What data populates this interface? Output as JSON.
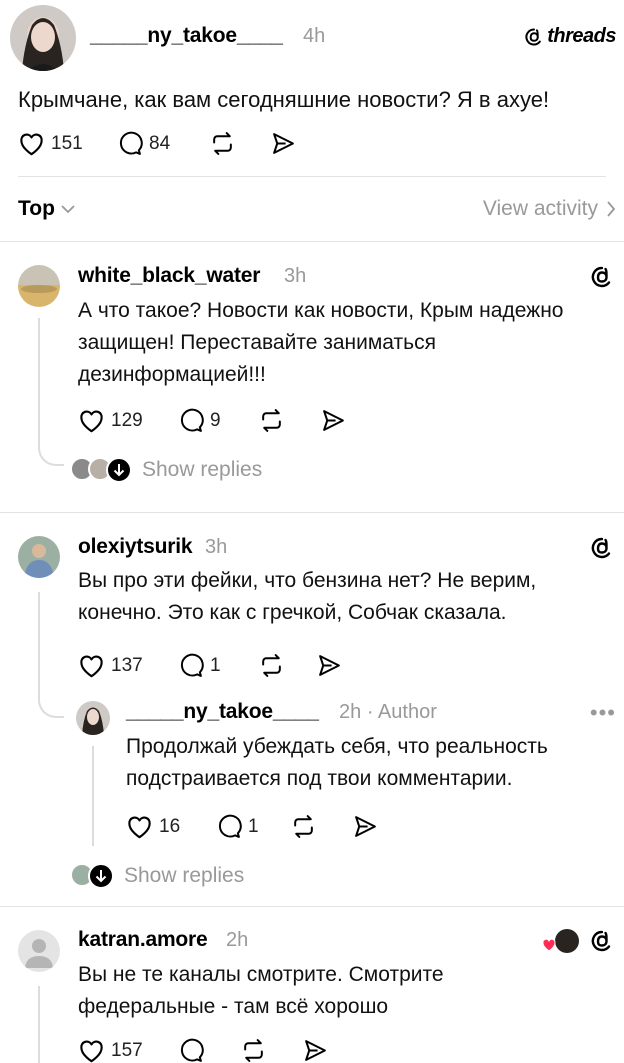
{
  "brand": {
    "logo_text": "threads"
  },
  "post": {
    "author": "_____ny_takoe____",
    "time": "4h",
    "text": "Крымчане, как вам сегодняшние новости? Я в ахуе!",
    "likes": "151",
    "replies": "84"
  },
  "filter": {
    "sort_label": "Top",
    "view_activity": "View activity"
  },
  "comments": [
    {
      "author": "white_black_water",
      "time": "3h",
      "lines": [
        "А что такое? Новости как новости, Крым надежно",
        "защищен! Переставайте заниматься",
        "дезинформацией!!!"
      ],
      "likes": "129",
      "replies": "9",
      "show_replies": "Show replies"
    },
    {
      "author": "olexiytsurik",
      "time": "3h",
      "lines": [
        "Вы про эти фейки, что бензина нет? Не верим,",
        "конечно. Это как с гречкой, Собчак сказала."
      ],
      "likes": "137",
      "replies": "1",
      "reply": {
        "author": "_____ny_takoe____",
        "time": "2h",
        "badge": "· Author",
        "lines": [
          "Продолжай убеждать себя, что реальность",
          "подстраивается под твои комментарии."
        ],
        "likes": "16",
        "replies": "1"
      },
      "show_replies": "Show replies"
    },
    {
      "author": "katran.amore",
      "time": "2h",
      "lines": [
        "Вы не те каналы смотрите. Смотрите",
        "федеральные - там всё хорошо"
      ],
      "likes": "157"
    }
  ],
  "colors": {
    "accent_heart": "#ff2d55",
    "muted": "#999999",
    "divider": "#e3e3e3"
  },
  "icons": [
    "heart-icon",
    "comment-icon",
    "repost-icon",
    "share-icon",
    "threads-logo-icon",
    "chevron-down-icon",
    "chevron-right-icon",
    "more-icon",
    "arrow-down-icon"
  ]
}
